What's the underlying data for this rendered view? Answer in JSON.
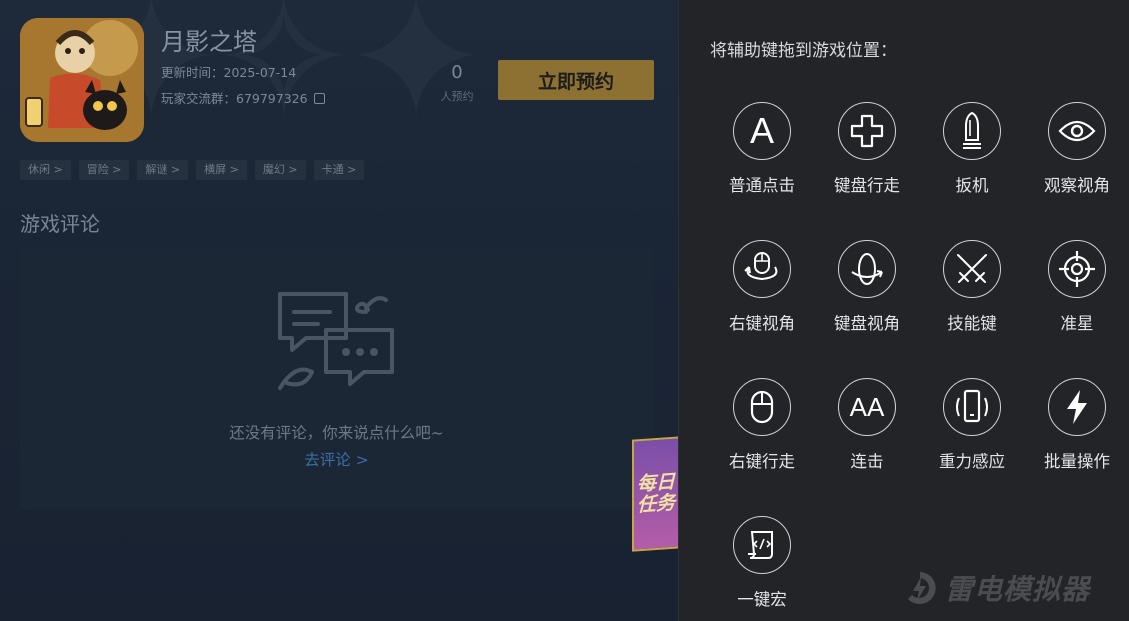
{
  "game": {
    "title": "月影之塔",
    "update_text": "更新时间：2025-07-14",
    "group_text": "玩家交流群：679797326",
    "reserve_count": "0",
    "reserve_count_label": "人预约",
    "reserve_button": "立即预约"
  },
  "tags": [
    "休闲 >",
    "冒险 >",
    "解谜 >",
    "横屏 >",
    "魔幻 >",
    "卡通 >"
  ],
  "comments": {
    "section_title": "游戏评论",
    "empty_text": "还没有评论，你来说点什么吧~",
    "go_comment_link": "去评论 >"
  },
  "daily_task": {
    "line1": "每日",
    "line2": "任务"
  },
  "panel": {
    "heading": "将辅助键拖到游戏位置：",
    "keys": [
      {
        "label": "普通点击",
        "icon": "letter-a-icon"
      },
      {
        "label": "键盘行走",
        "icon": "dpad-icon"
      },
      {
        "label": "扳机",
        "icon": "bullet-icon"
      },
      {
        "label": "观察视角",
        "icon": "eye-icon"
      },
      {
        "label": "右键视角",
        "icon": "mouse-rotate-icon"
      },
      {
        "label": "键盘视角",
        "icon": "rotate-view-icon"
      },
      {
        "label": "技能键",
        "icon": "crossed-swords-icon"
      },
      {
        "label": "准星",
        "icon": "crosshair-icon"
      },
      {
        "label": "右键行走",
        "icon": "mouse-icon"
      },
      {
        "label": "连击",
        "icon": "double-a-icon"
      },
      {
        "label": "重力感应",
        "icon": "phone-tilt-icon"
      },
      {
        "label": "批量操作",
        "icon": "lightning-icon"
      },
      {
        "label": "一键宏",
        "icon": "macro-script-icon"
      }
    ],
    "key_double_a_text": "AA",
    "key_a_text": "A"
  },
  "brand": {
    "logo_text": "雷电模拟器"
  },
  "colors": {
    "reserve_button_bg": "#8c7133",
    "link_blue": "#3c6ea8",
    "panel_bg": "#232428"
  }
}
